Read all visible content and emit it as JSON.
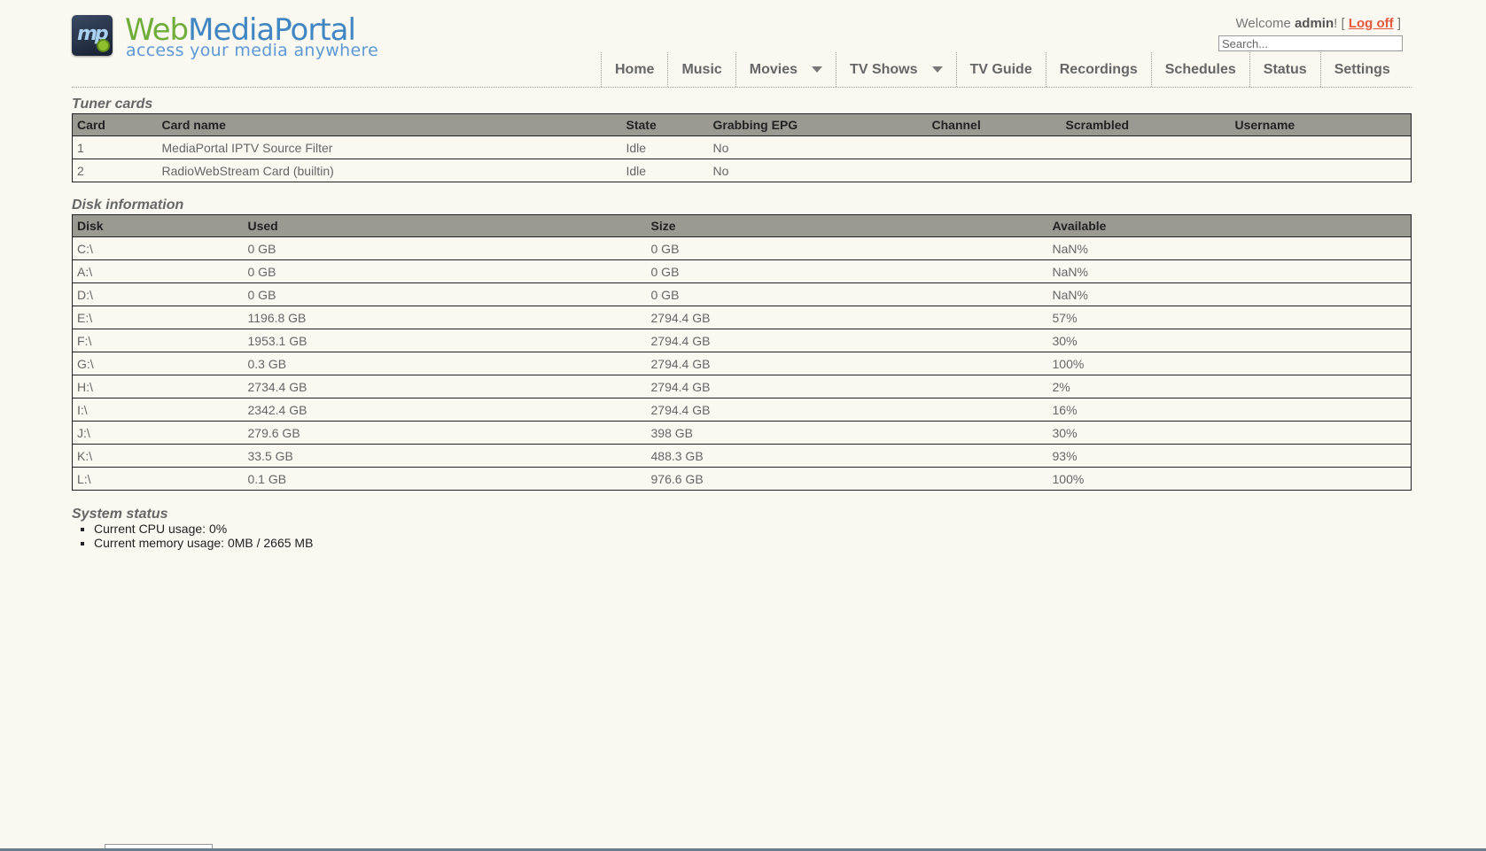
{
  "header": {
    "logo_title_part1": "Web",
    "logo_title_part2": "MediaPortal",
    "logo_tagline": "access your media anywhere",
    "welcome_prefix": "Welcome",
    "username": "admin",
    "welcome_suffix": "! [",
    "logoff_label": "Log off",
    "bracket_close": "]",
    "search_placeholder": "Search..."
  },
  "nav": {
    "items": [
      {
        "label": "Home"
      },
      {
        "label": "Music"
      },
      {
        "label": "Movies"
      },
      {
        "label": "TV Shows"
      },
      {
        "label": "TV Guide"
      },
      {
        "label": "Recordings"
      },
      {
        "label": "Schedules"
      },
      {
        "label": "Status"
      },
      {
        "label": "Settings"
      }
    ]
  },
  "tuner": {
    "title": "Tuner cards",
    "headers": [
      "Card",
      "Card name",
      "State",
      "Grabbing EPG",
      "Channel",
      "Scrambled",
      "Username"
    ],
    "rows": [
      [
        "1",
        "MediaPortal IPTV Source Filter",
        "Idle",
        "No",
        "",
        "",
        ""
      ],
      [
        "2",
        "RadioWebStream Card (builtin)",
        "Idle",
        "No",
        "",
        "",
        ""
      ]
    ]
  },
  "disk": {
    "title": "Disk information",
    "headers": [
      "Disk",
      "Used",
      "Size",
      "Available"
    ],
    "rows": [
      [
        "C:\\",
        "0 GB",
        "0 GB",
        "NaN%"
      ],
      [
        "A:\\",
        "0 GB",
        "0 GB",
        "NaN%"
      ],
      [
        "D:\\",
        "0 GB",
        "0 GB",
        "NaN%"
      ],
      [
        "E:\\",
        "1196.8 GB",
        "2794.4 GB",
        "57%"
      ],
      [
        "F:\\",
        "1953.1 GB",
        "2794.4 GB",
        "30%"
      ],
      [
        "G:\\",
        "0.3 GB",
        "2794.4 GB",
        "100%"
      ],
      [
        "H:\\",
        "2734.4 GB",
        "2794.4 GB",
        "2%"
      ],
      [
        "I:\\",
        "2342.4 GB",
        "2794.4 GB",
        "16%"
      ],
      [
        "J:\\",
        "279.6 GB",
        "398 GB",
        "30%"
      ],
      [
        "K:\\",
        "33.5 GB",
        "488.3 GB",
        "93%"
      ],
      [
        "L:\\",
        "0.1 GB",
        "976.6 GB",
        "100%"
      ]
    ]
  },
  "system": {
    "title": "System status",
    "cpu": "Current CPU usage: 0%",
    "memory": "Current memory usage: 0MB / 2665 MB"
  },
  "colors": {
    "background": "#faf8f0",
    "table_header": "#9a9a93",
    "low_space": "#cc0000",
    "logoff_link": "#e2583e"
  }
}
